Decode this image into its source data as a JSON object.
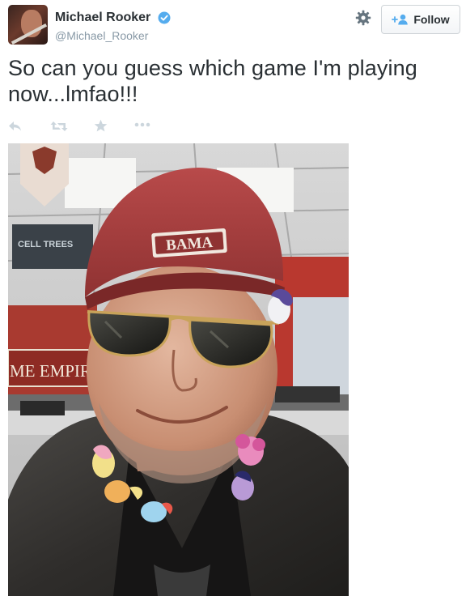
{
  "author": {
    "display_name": "Michael Rooker",
    "handle": "@Michael_Rooker",
    "verified": true
  },
  "header": {
    "follow_label": "Follow"
  },
  "tweet": {
    "text": "So can you guess which game I'm playing now...lmfao!!!"
  },
  "actions": {
    "icons": [
      "reply-icon",
      "retweet-icon",
      "favorite-icon",
      "more-icon"
    ]
  },
  "photo": {
    "cap_text": "BAMA",
    "sign_text": "ME EMPIRE",
    "poster_text": "CELL TREES"
  },
  "colors": {
    "accent_blue": "#55acee",
    "text": "#292f33",
    "muted": "#8899a6",
    "action_icon": "#ccd6dd"
  }
}
